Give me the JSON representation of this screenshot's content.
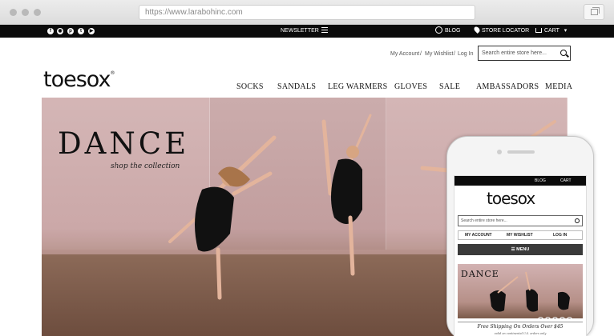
{
  "browser": {
    "url": "https://www.larabohinc.com"
  },
  "topbar": {
    "social": [
      "f",
      "◉",
      "p",
      "t",
      "▶"
    ],
    "newsletter": "NEWSLETTER",
    "blog": "BLOG",
    "store_locator": "STORE LOCATOR",
    "cart": "CART"
  },
  "header": {
    "my_account": "My Account",
    "my_wishlist": "My Wishlist",
    "log_in": "Log In",
    "separator": "/",
    "search_placeholder": "Search entire store here...",
    "logo": "toesox",
    "logo_mark": "®"
  },
  "nav": [
    "SOCKS",
    "SANDALS",
    "LEG WARMERS",
    "GLOVES",
    "SALE",
    "AMBASSADORS",
    "MEDIA"
  ],
  "hero": {
    "title": "DANCE",
    "subtitle": "shop the collection"
  },
  "mobile": {
    "blog": "BLOG",
    "cart": "CART",
    "logo": "toesox",
    "search_placeholder": "Search entire store here...",
    "links": [
      "MY ACCOUNT",
      "MY WISHLIST",
      "LOG IN"
    ],
    "menu": "MENU",
    "hero_title": "DANCE",
    "shipping": "Free Shipping On Orders Over $45",
    "shipping_note": "valid on continental U.S. orders only"
  },
  "colors": {
    "topbar": "#0b0b0b",
    "hero_wall": "#d2b2b2",
    "floor": "#7b5a49"
  }
}
